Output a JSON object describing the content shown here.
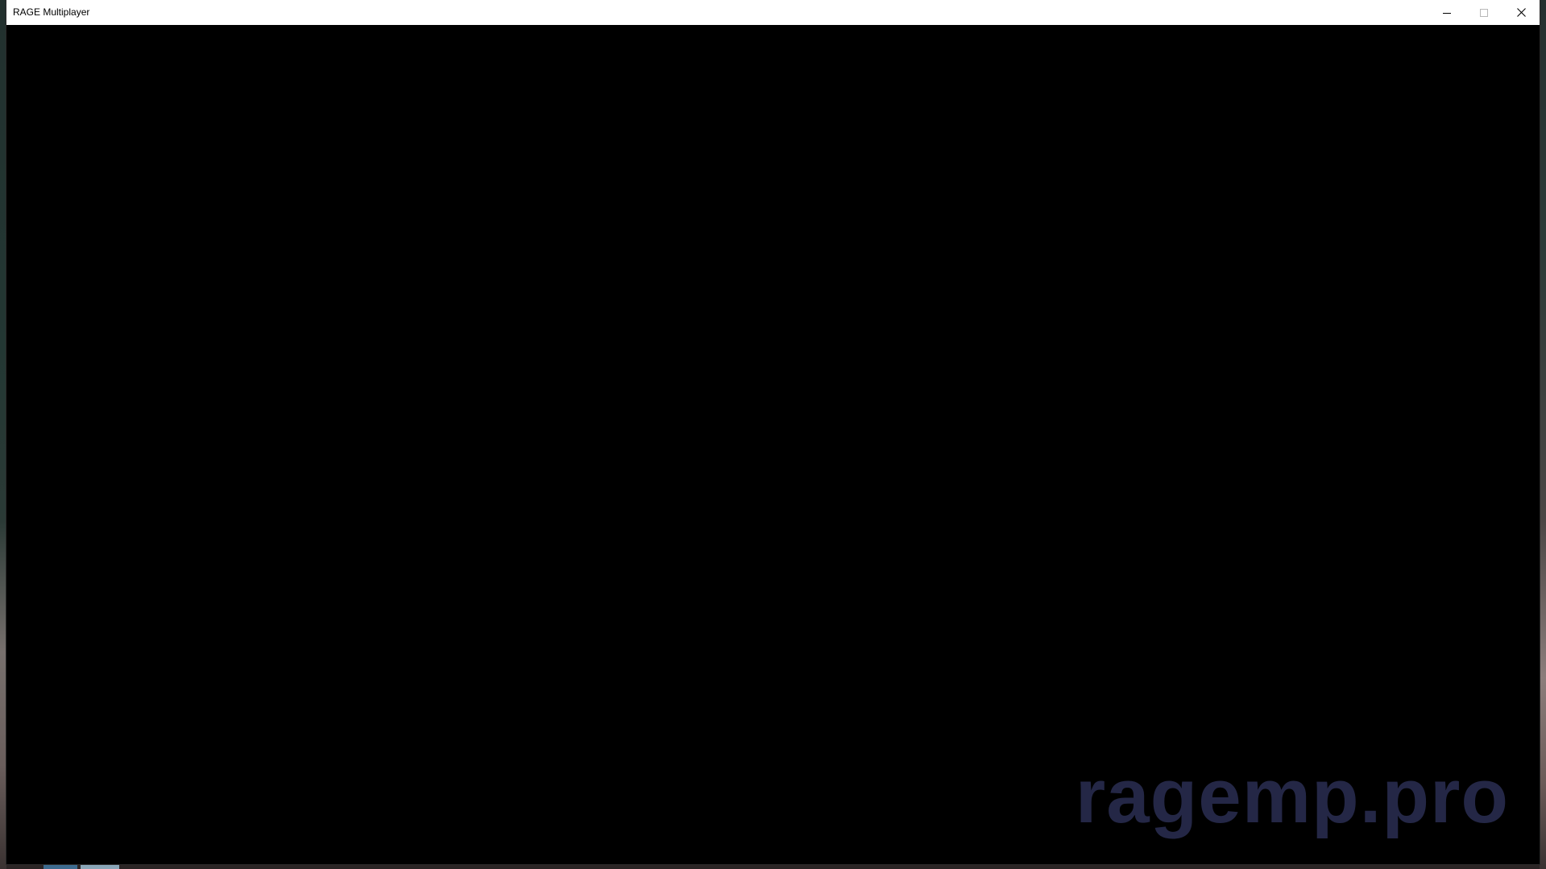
{
  "window": {
    "title": "RAGE Multiplayer",
    "controls": {
      "minimize_icon": "minimize-icon",
      "maximize_icon": "maximize-icon",
      "close_icon": "close-icon"
    }
  },
  "content": {
    "watermark": "ragemp.pro",
    "watermark_color": "#262a4a",
    "background_color": "#000000"
  }
}
